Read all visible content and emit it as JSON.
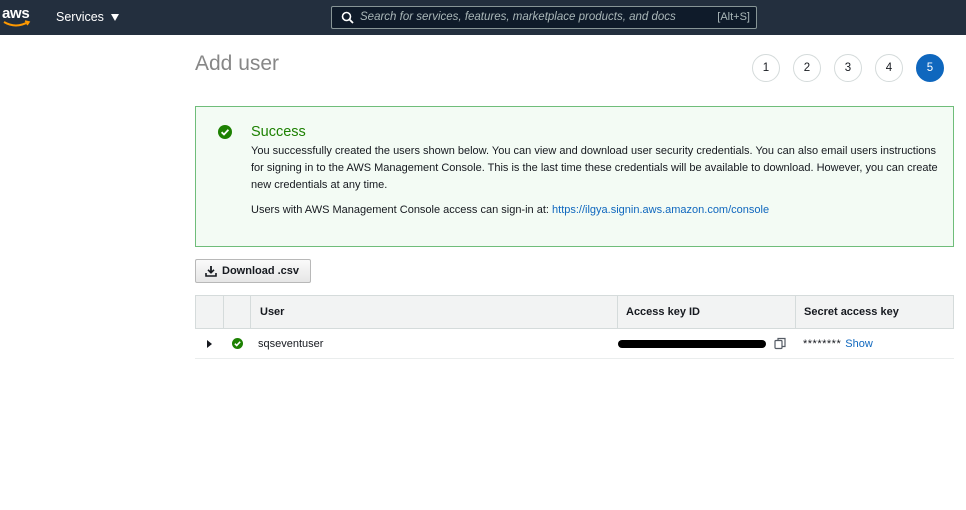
{
  "nav": {
    "logo_text": "aws",
    "services_label": "Services",
    "search_placeholder": "Search for services, features, marketplace products, and docs",
    "search_shortcut": "[Alt+S]"
  },
  "page": {
    "title": "Add user",
    "steps": [
      "1",
      "2",
      "3",
      "4",
      "5"
    ],
    "active_step": "5"
  },
  "success": {
    "title": "Success",
    "message": "You successfully created the users shown below. You can view and download user security credentials. You can also email users instructions for signing in to the AWS Management Console. This is the last time these credentials will be available to download. However, you can create new credentials at any time.",
    "signin_prefix": "Users with AWS Management Console access can sign-in at: ",
    "signin_url": "https://ilgya.signin.aws.amazon.com/console"
  },
  "download_label": "Download .csv",
  "table": {
    "headers": {
      "user": "User",
      "access_key_id": "Access key ID",
      "secret_access_key": "Secret access key"
    },
    "rows": [
      {
        "user": "sqseventuser",
        "access_key_id_redacted": true,
        "secret_mask": "********",
        "show_label": "Show"
      }
    ]
  },
  "colors": {
    "nav_bg": "#232f3e",
    "success_green": "#1d8102",
    "link_blue": "#0f67be"
  }
}
